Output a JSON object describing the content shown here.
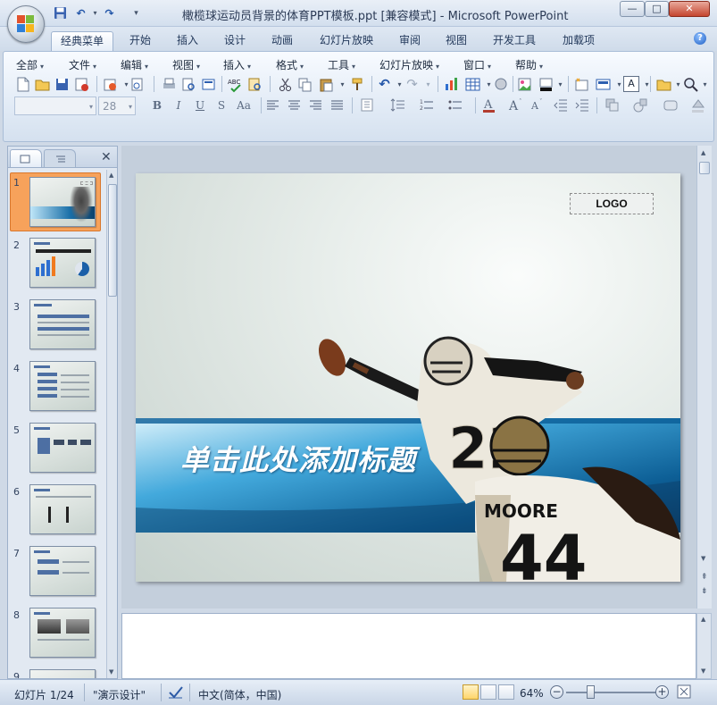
{
  "window": {
    "title": "橄榄球运动员背景的体育PPT模板.ppt [兼容模式] - Microsoft PowerPoint",
    "controls": {
      "minimize": "—",
      "maximize": "□",
      "close": "✕"
    }
  },
  "quick_access": {
    "save": "save-icon",
    "undo": "↶",
    "redo": "↷",
    "customize": "▾"
  },
  "tabs": [
    {
      "label": "经典菜单",
      "active": true
    },
    {
      "label": "开始"
    },
    {
      "label": "插入"
    },
    {
      "label": "设计"
    },
    {
      "label": "动画"
    },
    {
      "label": "幻灯片放映"
    },
    {
      "label": "审阅"
    },
    {
      "label": "视图"
    },
    {
      "label": "开发工具"
    },
    {
      "label": "加载项"
    }
  ],
  "menus": [
    "全部",
    "文件",
    "编辑",
    "视图",
    "插入",
    "格式",
    "工具",
    "幻灯片放映",
    "窗口",
    "帮助"
  ],
  "font": {
    "name": "",
    "size": "28"
  },
  "format_buttons": {
    "bold": "B",
    "italic": "I",
    "underline": "U",
    "shadow": "S",
    "case": "Aa"
  },
  "tools": {
    "box_label": "A"
  },
  "left_pane": {
    "close": "✕"
  },
  "thumbnails": [
    {
      "num": "1",
      "selected": true
    },
    {
      "num": "2"
    },
    {
      "num": "3"
    },
    {
      "num": "4"
    },
    {
      "num": "5"
    },
    {
      "num": "6"
    },
    {
      "num": "7"
    },
    {
      "num": "8"
    },
    {
      "num": "9"
    }
  ],
  "slide": {
    "logo": "LOGO",
    "title": "单击此处添加标题",
    "jersey_number_1": "22",
    "jersey_name": "MOORE",
    "jersey_number_2": "44"
  },
  "status": {
    "slide_info": "幻灯片 1/24",
    "theme": "\"演示设计\"",
    "language": "中文(简体，中国)",
    "zoom": "64%",
    "zoom_level": 0.64
  },
  "colors": {
    "accent_blue": "#1a6fa8",
    "banner_light": "#8fd0ef",
    "thumb_selected": "#f7a25b"
  }
}
